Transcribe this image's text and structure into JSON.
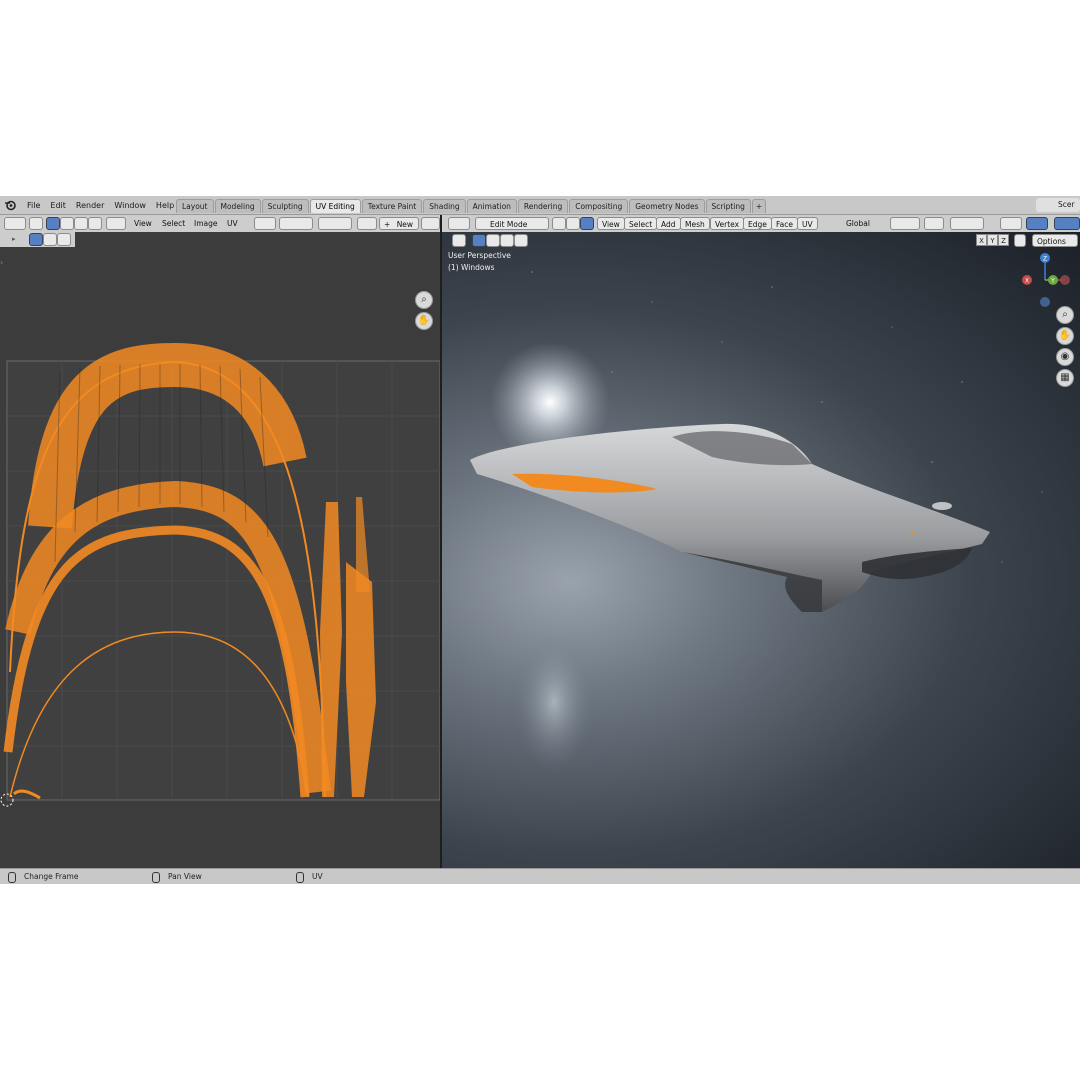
{
  "menu": {
    "file": "File",
    "edit": "Edit",
    "render": "Render",
    "window": "Window",
    "help": "Help"
  },
  "workspaces": [
    {
      "label": "Layout",
      "active": false
    },
    {
      "label": "Modeling",
      "active": false
    },
    {
      "label": "Sculpting",
      "active": false
    },
    {
      "label": "UV Editing",
      "active": true
    },
    {
      "label": "Texture Paint",
      "active": false
    },
    {
      "label": "Shading",
      "active": false
    },
    {
      "label": "Animation",
      "active": false
    },
    {
      "label": "Rendering",
      "active": false
    },
    {
      "label": "Compositing",
      "active": false
    },
    {
      "label": "Geometry Nodes",
      "active": false
    },
    {
      "label": "Scripting",
      "active": false
    }
  ],
  "add_workspace": "+",
  "scene_label": "Scer",
  "uv_editor": {
    "view": "View",
    "select": "Select",
    "image": "Image",
    "uv": "UV",
    "new_button": "New",
    "new_plus": "+"
  },
  "viewport": {
    "mode": "Edit Mode",
    "view": "View",
    "select": "Select",
    "add": "Add",
    "mesh": "Mesh",
    "vertex": "Vertex",
    "edge": "Edge",
    "face": "Face",
    "uv": "UV",
    "orientation": "Global",
    "options": "Options",
    "axis_x": "X",
    "axis_y": "Y",
    "axis_z": "Z",
    "perspective": "User Perspective",
    "object": "(1) Windows"
  },
  "status": {
    "change_frame": "Change Frame",
    "pan_view": "Pan View",
    "uv": "UV"
  },
  "colors": {
    "accent": "#f28a22",
    "active_tab": "#e8e8e8",
    "selection": "#5680c2"
  }
}
